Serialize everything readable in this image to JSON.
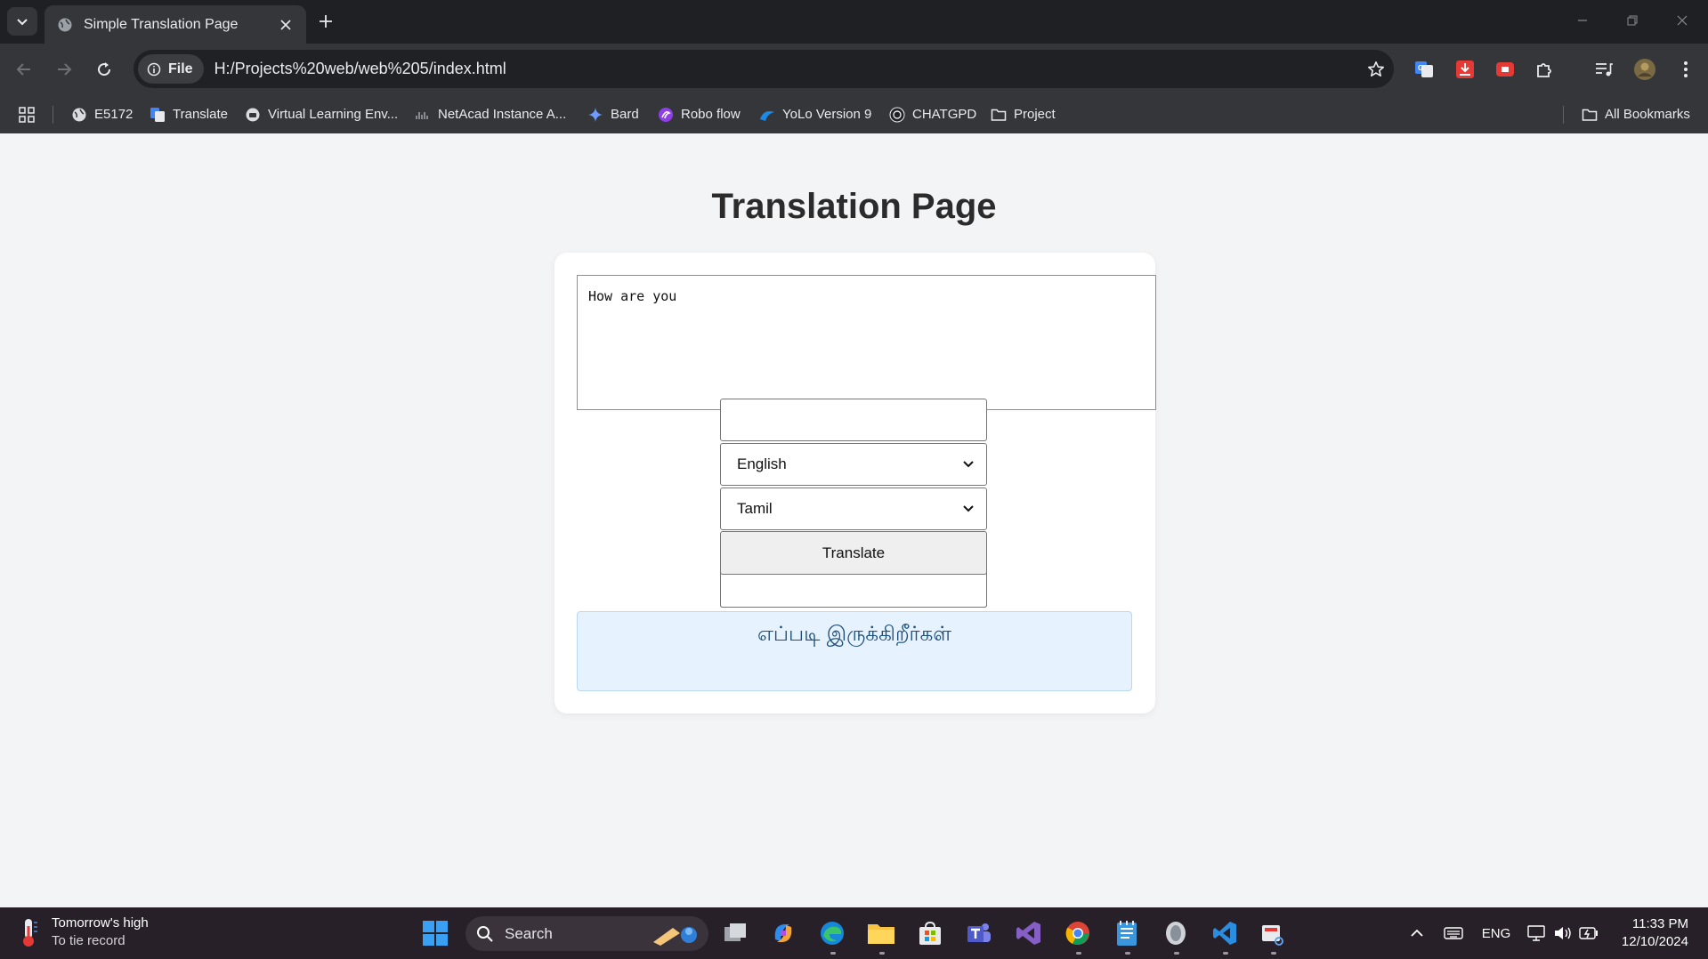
{
  "browser": {
    "tab_title": "Simple Translation Page",
    "url_scheme_label": "File",
    "url": "H:/Projects%20web/web%205/index.html",
    "bookmarks": [
      {
        "label": "E5172",
        "icon": "globe-icon"
      },
      {
        "label": "Translate",
        "icon": "google-translate-icon"
      },
      {
        "label": "Virtual Learning Env...",
        "icon": "robot-icon"
      },
      {
        "label": "NetAcad Instance A...",
        "icon": "cisco-icon"
      },
      {
        "label": "Bard",
        "icon": "sparkle-icon"
      },
      {
        "label": "Robo flow",
        "icon": "roboflow-icon"
      },
      {
        "label": "YoLo Version 9",
        "icon": "yolo-icon"
      },
      {
        "label": "CHATGPD",
        "icon": "openai-icon"
      },
      {
        "label": "Project",
        "icon": "folder-icon"
      }
    ],
    "all_bookmarks_label": "All Bookmarks"
  },
  "page": {
    "title": "Translation Page",
    "source_text": "How are you",
    "source_language": "English",
    "target_language": "Tamil",
    "translate_label": "Translate",
    "result_text": "எப்படி இருக்கிறீர்கள்"
  },
  "taskbar": {
    "weather_title": "Tomorrow's high",
    "weather_sub": "To tie record",
    "search_label": "Search",
    "language": "ENG",
    "time": "11:33 PM",
    "date": "12/10/2024"
  },
  "colors": {
    "accent": "#1d4f7a",
    "result_bg": "#e6f2fd",
    "page_bg": "#f3f4f6",
    "chrome_dark": "#35363a"
  }
}
